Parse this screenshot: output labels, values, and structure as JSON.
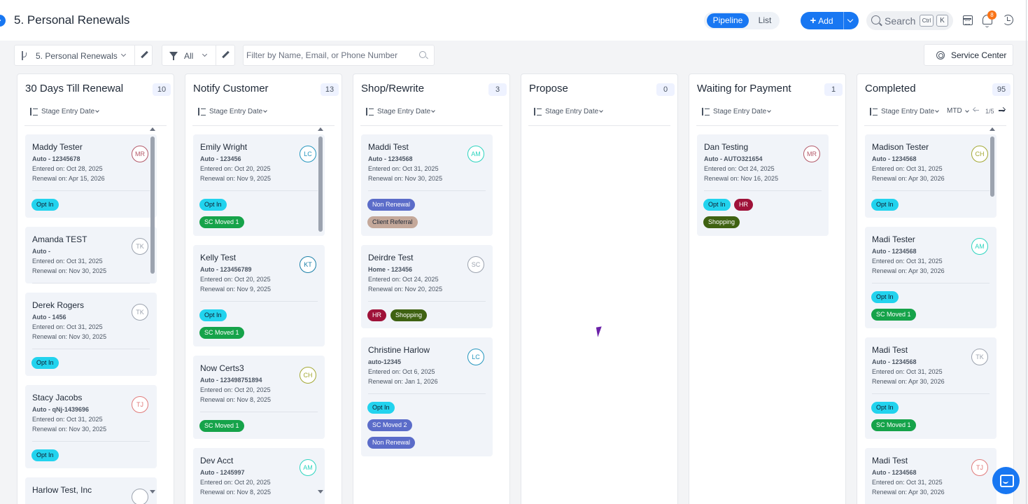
{
  "header": {
    "title": "5. Personal Renewals",
    "view_pipeline": "Pipeline",
    "view_list": "List",
    "add_label": "Add",
    "search_label": "Search",
    "shortcut_ctrl": "Ctrl",
    "shortcut_key": "K",
    "notification_count": "8"
  },
  "toolbar": {
    "pipeline_name": "5. Personal Renewals",
    "filter_value": "All",
    "filter_placeholder": "Filter by Name, Email, or Phone Number",
    "service_center": "Service Center"
  },
  "sort_label": "Stage Entry Date",
  "completed_extras": {
    "period": "MTD",
    "page": "1/5"
  },
  "stages": [
    {
      "title": "30 Days Till Renewal",
      "count": "10",
      "cards": [
        {
          "name": "Maddy Tester",
          "line1": "Auto - 12345678",
          "line2": "Entered on: Oct 28, 2025",
          "line3": "Renewal on: Apr 15, 2026",
          "avatar": "MR",
          "tags": [
            "Opt In"
          ]
        },
        {
          "name": "Amanda TEST",
          "line1": "Auto -",
          "line2": "Entered on: Oct 31, 2025",
          "line3": "Renewal on: Nov 30, 2025",
          "avatar": "TK",
          "tags": []
        },
        {
          "name": "Derek Rogers",
          "line1": "Auto - 1456",
          "line2": "Entered on: Oct 31, 2025",
          "line3": "Renewal on: Nov 30, 2025",
          "avatar": "TK",
          "tags": [
            "Opt In"
          ]
        },
        {
          "name": "Stacy Jacobs",
          "line1": "Auto - qNj-1439696",
          "line2": "Entered on: Oct 31, 2025",
          "line3": "Renewal on: Nov 30, 2025",
          "avatar": "TJ",
          "tags": [
            "Opt In"
          ]
        },
        {
          "name": "Harlow Test, Inc",
          "line1": "",
          "line2": "",
          "line3": "",
          "avatar": "",
          "tags": []
        }
      ]
    },
    {
      "title": "Notify Customer",
      "count": "13",
      "cards": [
        {
          "name": "Emily Wright",
          "line1": "Auto - 123456",
          "line2": "Entered on: Oct 20, 2025",
          "line3": "Renewal on: Nov 9, 2025",
          "avatar": "LC",
          "tags": [
            "Opt In",
            "SC Moved 1"
          ]
        },
        {
          "name": "Kelly Test",
          "line1": "Auto - 123456789",
          "line2": "Entered on: Oct 20, 2025",
          "line3": "Renewal on: Nov 9, 2025",
          "avatar": "KT",
          "tags": [
            "Opt In",
            "SC Moved 1"
          ]
        },
        {
          "name": "Now Certs3",
          "line1": "Auto - 123498751894",
          "line2": "Entered on: Oct 20, 2025",
          "line3": "Renewal on: Nov 8, 2025",
          "avatar": "CH",
          "tags": [
            "SC Moved 1"
          ]
        },
        {
          "name": "Dev Acct",
          "line1": "Auto - 1245997",
          "line2": "Entered on: Oct 20, 2025",
          "line3": "Renewal on: Nov 8, 2025",
          "avatar": "AM",
          "tags": []
        }
      ]
    },
    {
      "title": "Shop/Rewrite",
      "count": "3",
      "cards": [
        {
          "name": "Maddi Test",
          "line1": "Auto - 1234568",
          "line2": "Entered on: Oct 31, 2025",
          "line3": "Renewal on: Nov 30, 2025",
          "avatar": "AM",
          "tags": [
            "Non Renewal",
            "Client Referral"
          ]
        },
        {
          "name": "Deirdre Test",
          "line1": "Home - 123456",
          "line2": "Entered on: Oct 24, 2025",
          "line3": "Renewal on: Nov 20, 2025",
          "avatar": "SC",
          "tags": [
            "HR",
            "Shopping"
          ]
        },
        {
          "name": "Christine Harlow",
          "line1": "auto-12345",
          "line2": "Entered on: Oct 6, 2025",
          "line3": "Renewal on: Jan 1, 2026",
          "avatar": "LC",
          "tags": [
            "Opt In",
            "SC Moved 2",
            "Non Renewal"
          ]
        }
      ]
    },
    {
      "title": "Propose",
      "count": "0",
      "cards": []
    },
    {
      "title": "Waiting for Payment",
      "count": "1",
      "cards": [
        {
          "name": "Dan Testing",
          "line1": "Auto - AUTO321654",
          "line2": "Entered on: Oct 24, 2025",
          "line3": "Renewal on: Nov 16, 2025",
          "avatar": "MR",
          "tags": [
            "Opt In",
            "HR",
            "Shopping"
          ]
        }
      ]
    },
    {
      "title": "Completed",
      "count": "95",
      "cards": [
        {
          "name": "Madison Tester",
          "line1": "Auto - 1234568",
          "line2": "Entered on: Oct 31, 2025",
          "line3": "Renewal on: Apr 30, 2026",
          "avatar": "CH",
          "tags": [
            "Opt In"
          ]
        },
        {
          "name": "Madi Tester",
          "line1": "Auto - 1234568",
          "line2": "Entered on: Oct 31, 2025",
          "line3": "Renewal on: Apr 30, 2026",
          "avatar": "AM",
          "tags": [
            "Opt In",
            "SC Moved 1"
          ]
        },
        {
          "name": "Madi Test",
          "line1": "Auto - 1234568",
          "line2": "Entered on: Oct 31, 2025",
          "line3": "Renewal on: Apr 30, 2026",
          "avatar": "TK",
          "tags": [
            "Opt In",
            "SC Moved 1"
          ]
        },
        {
          "name": "Madi Test",
          "line1": "Auto - 1234568",
          "line2": "Entered on: Oct 31, 2025",
          "line3": "Renewal on: Apr 30, 2026",
          "avatar": "TJ",
          "tags": []
        }
      ]
    }
  ],
  "tag_colors": {
    "Opt In": {
      "bg": "#22d3ee",
      "fg": "#0f172a"
    },
    "SC Moved 1": {
      "bg": "#16a34a",
      "fg": "#ffffff"
    },
    "SC Moved 2": {
      "bg": "#5b6cc9",
      "fg": "#ffffff"
    },
    "Non Renewal": {
      "bg": "#5b6cc9",
      "fg": "#ffffff"
    },
    "Client Referral": {
      "bg": "#c4a89a",
      "fg": "#1f2937"
    },
    "HR": {
      "bg": "#9f1239",
      "fg": "#ffffff"
    },
    "Shopping": {
      "bg": "#3f6212",
      "fg": "#ffffff"
    }
  },
  "avatar_colors": {
    "MR": "#b45a6a",
    "TK": "#9ca3af",
    "TJ": "#e07b7b",
    "LC": "#2596be",
    "KT": "#1a7fa8",
    "CH": "#a3a834",
    "AM": "#2dd4bf",
    "SC": "#9ca3af"
  },
  "colors": {
    "accent": "#1877f2",
    "badge": "#f97316"
  }
}
